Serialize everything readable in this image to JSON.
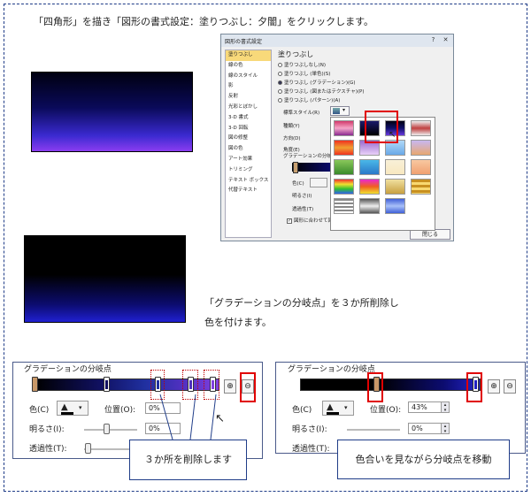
{
  "instructions": {
    "line1": "「四角形」を描き「図形の書式設定：塗りつぶし：夕闇」をクリックします。",
    "line2a": "「グラデーションの分岐点」を３か所削除し",
    "line2b": "色を付けます。"
  },
  "dialog": {
    "title": "図形の書式設定",
    "nav_items": [
      "塗りつぶし",
      "線の色",
      "線のスタイル",
      "影",
      "反射",
      "光彩とぼかし",
      "3-D 書式",
      "3-D 回転",
      "図の修整",
      "図の色",
      "アート効果",
      "トリミング",
      "テキスト ボックス",
      "代替テキスト"
    ],
    "panel_heading": "塗りつぶし",
    "fill_options": [
      "塗りつぶしなし(N)",
      "塗りつぶし (単色)(S)",
      "塗りつぶし (グラデーション)(G)",
      "塗りつぶし (図またはテクスチャ)(P)",
      "塗りつぶし (パターン)(A)"
    ],
    "preset_label": "標準スタイル(R)",
    "type_label": "種類(Y)",
    "direction_label": "方向(D)",
    "angle_label": "角度(E)",
    "stops_label": "グラデーションの分岐点",
    "color_label": "色(C)",
    "brightness_label": "明るさ(I)",
    "transparency_label": "透過性(T)",
    "rotate_label": "図形に合わせて回転する(W)",
    "close_button": "閉じる"
  },
  "left_panel": {
    "title": "グラデーションの分岐点",
    "color_label": "色(C)",
    "position_label": "位置(O):",
    "position_value": "0%",
    "brightness_label": "明るさ(I):",
    "brightness_value": "0%",
    "transparency_label": "透過性(T):",
    "callout": "３か所を削除します"
  },
  "right_panel": {
    "title": "グラデーションの分岐点",
    "color_label": "色(C)",
    "position_label": "位置(O):",
    "position_value": "43%",
    "brightness_label": "明るさ(I):",
    "brightness_value": "0%",
    "transparency_label": "透過性(T):",
    "callout": "色合いを見ながら分岐点を移動"
  },
  "icons": [
    "minimize-icon",
    "close-icon",
    "paint-bucket-icon",
    "add-stop-icon",
    "remove-stop-icon",
    "cursor-icon"
  ]
}
